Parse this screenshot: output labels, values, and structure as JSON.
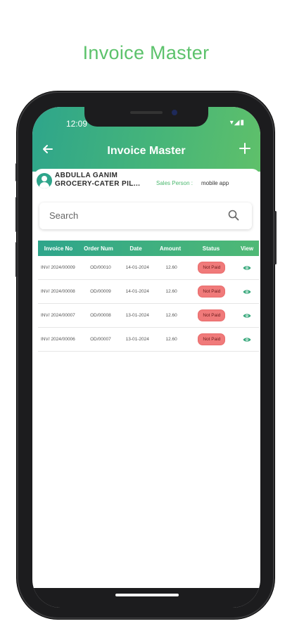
{
  "promo_title": "Invoice Master",
  "status_bar": {
    "time": "12:09",
    "icons": "▾◢▮"
  },
  "header": {
    "title": "Invoice Master",
    "back_icon": "arrow-left-icon",
    "add_icon": "plus-icon"
  },
  "customer": {
    "name": "ABDULLA GANIM GROCERY-CATER PIL...",
    "sales_person_label": "Sales Person :",
    "sales_person_value": "mobile app"
  },
  "search": {
    "placeholder": "Search"
  },
  "table": {
    "headers": [
      "Invoice No",
      "Order Num",
      "Date",
      "Amount",
      "Status",
      "View"
    ],
    "rows": [
      {
        "invoice_no": "INV/ 2024/00009",
        "order_num": "OD/00010",
        "date": "14-01-2024",
        "amount": "12.60",
        "status": "Not Paid"
      },
      {
        "invoice_no": "INV/ 2024/00008",
        "order_num": "OD/00009",
        "date": "14-01-2024",
        "amount": "12.60",
        "status": "Not Paid"
      },
      {
        "invoice_no": "INV/ 2024/00007",
        "order_num": "OD/00008",
        "date": "13-01-2024",
        "amount": "12.60",
        "status": "Not Paid"
      },
      {
        "invoice_no": "INV/ 2024/00006",
        "order_num": "OD/00007",
        "date": "13-01-2024",
        "amount": "12.60",
        "status": "Not Paid"
      }
    ]
  },
  "colors": {
    "accent": "#2ea58b",
    "accent_light": "#5fc06a",
    "badge": "#f07a7a",
    "promo_text": "#5cc26b"
  }
}
